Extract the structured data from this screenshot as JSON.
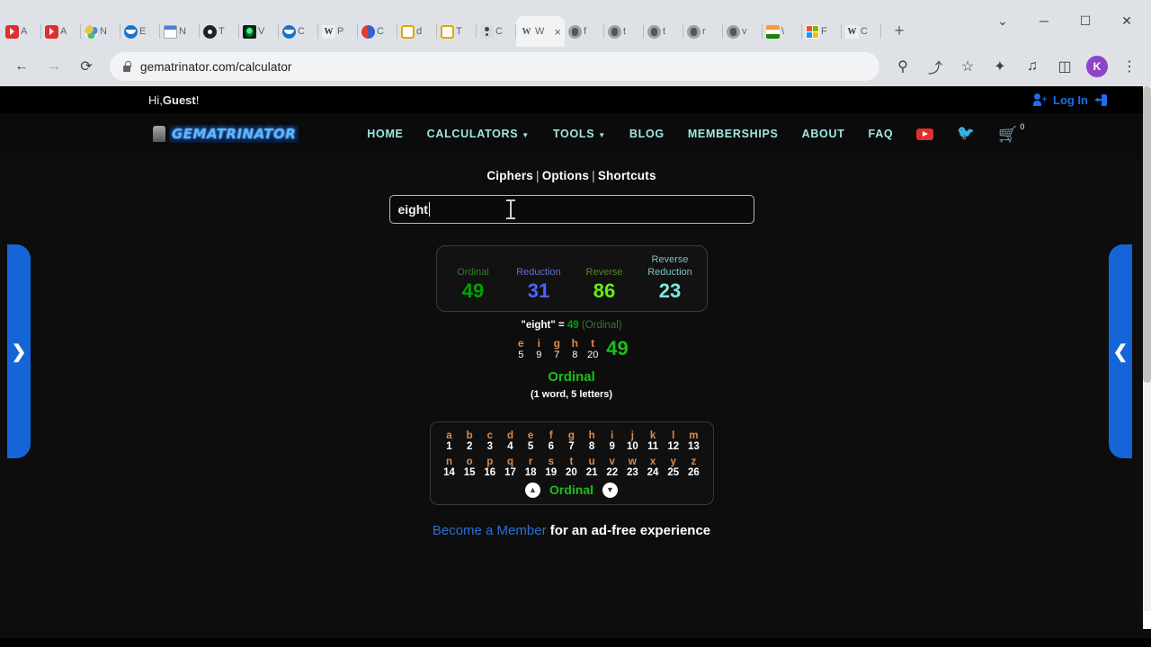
{
  "browser": {
    "tabs": [
      {
        "favicon": "youtube-icon",
        "letter": "A"
      },
      {
        "favicon": "youtube-icon",
        "letter": "A"
      },
      {
        "favicon": "multicolor-icon",
        "letter": "N"
      },
      {
        "favicon": "blue-circle-icon",
        "letter": "E"
      },
      {
        "favicon": "calendar-icon",
        "letter": "N"
      },
      {
        "favicon": "dark-disc-icon",
        "letter": "T"
      },
      {
        "favicon": "green-eye-icon",
        "letter": "V"
      },
      {
        "favicon": "crest-icon",
        "letter": "C"
      },
      {
        "favicon": "wikipedia-icon",
        "letter": "P"
      },
      {
        "favicon": "yinyang-icon",
        "letter": "C"
      },
      {
        "favicon": "orange-box-icon",
        "letter": "d"
      },
      {
        "favicon": "orange-box-icon",
        "letter": "T"
      },
      {
        "favicon": "person-icon",
        "letter": "C"
      },
      {
        "favicon": "w-icon",
        "letter": "W",
        "active": true,
        "close": "×"
      },
      {
        "favicon": "gray-bust-icon",
        "letter": "f"
      },
      {
        "favicon": "gray-bust-icon",
        "letter": "t"
      },
      {
        "favicon": "gray-bust-icon",
        "letter": "t"
      },
      {
        "favicon": "gray-bust-icon",
        "letter": "r"
      },
      {
        "favicon": "gray-bust-icon",
        "letter": "v"
      },
      {
        "favicon": "india-flag-icon",
        "letter": "\\"
      },
      {
        "favicon": "microsoft-icon",
        "letter": "F"
      },
      {
        "favicon": "wiki-w-icon",
        "letter": "C"
      }
    ],
    "new_tab_label": "+",
    "window_controls": {
      "tab_search": "⌄",
      "minimize": "─",
      "maximize": "☐",
      "close": "✕"
    },
    "toolbar": {
      "back": "←",
      "forward": "→",
      "reload": "⟳",
      "url": "gematrinator.com/calculator",
      "search_icon": "⚲",
      "share_icon": "⤴",
      "bookmark_icon": "☆",
      "extensions_icon": "✦",
      "media_icon": "♫",
      "sidepanel_icon": "◫",
      "profile_initial": "K",
      "menu_icon": "⋮"
    }
  },
  "site": {
    "topbar": {
      "greeting_prefix": "Hi, ",
      "greeting_name": "Guest",
      "greeting_suffix": "!",
      "login_label": "Log In"
    },
    "logo_text": "GEMATRINATOR",
    "nav": [
      {
        "label": "HOME",
        "caret": false
      },
      {
        "label": "CALCULATORS",
        "caret": true
      },
      {
        "label": "TOOLS",
        "caret": true
      },
      {
        "label": "BLOG",
        "caret": false
      },
      {
        "label": "MEMBERSHIPS",
        "caret": false
      },
      {
        "label": "ABOUT",
        "caret": false
      },
      {
        "label": "FAQ",
        "caret": false
      }
    ],
    "cart_count": "0"
  },
  "calculator": {
    "tab_links": {
      "ciphers": "Ciphers",
      "options": "Options",
      "shortcuts": "Shortcuts",
      "separator": "|"
    },
    "search_value": "eight",
    "search_placeholder": "",
    "ciphers": [
      {
        "name": "Ordinal",
        "value": "49",
        "name_color": "#2f7a2f",
        "value_color": "#00a400"
      },
      {
        "name": "Reduction",
        "value": "31",
        "name_color": "#5f6fd0",
        "value_color": "#4f63ff"
      },
      {
        "name": "Reverse",
        "value": "86",
        "name_color": "#4d8b28",
        "value_color": "#66ee11"
      },
      {
        "name": "Reverse Reduction",
        "value": "23",
        "name_color": "#7fbfc4",
        "value_color": "#7fe8e0"
      }
    ],
    "equation": {
      "word": "\"eight\"",
      "equals": " = ",
      "value": "49",
      "cipher": "(Ordinal)"
    },
    "breakdown": {
      "letters": [
        "e",
        "i",
        "g",
        "h",
        "t"
      ],
      "values": [
        "5",
        "9",
        "7",
        "8",
        "20"
      ],
      "total": "49"
    },
    "active_cipher": "Ordinal",
    "count_text": "(1 word, 5 letters)",
    "chart": {
      "row1_letters": [
        "a",
        "b",
        "c",
        "d",
        "e",
        "f",
        "g",
        "h",
        "i",
        "j",
        "k",
        "l",
        "m"
      ],
      "row1_values": [
        "1",
        "2",
        "3",
        "4",
        "5",
        "6",
        "7",
        "8",
        "9",
        "10",
        "11",
        "12",
        "13"
      ],
      "row2_letters": [
        "n",
        "o",
        "p",
        "q",
        "r",
        "s",
        "t",
        "u",
        "v",
        "w",
        "x",
        "y",
        "z"
      ],
      "row2_values": [
        "14",
        "15",
        "16",
        "17",
        "18",
        "19",
        "20",
        "21",
        "22",
        "23",
        "24",
        "25",
        "26"
      ],
      "prev_icon": "▲",
      "next_icon": "▼",
      "label": "Ordinal"
    },
    "member_cta": {
      "link": "Become a Member",
      "rest": " for an ad-free experience"
    },
    "side_tabs": {
      "left": "❯",
      "right": "❮"
    }
  }
}
